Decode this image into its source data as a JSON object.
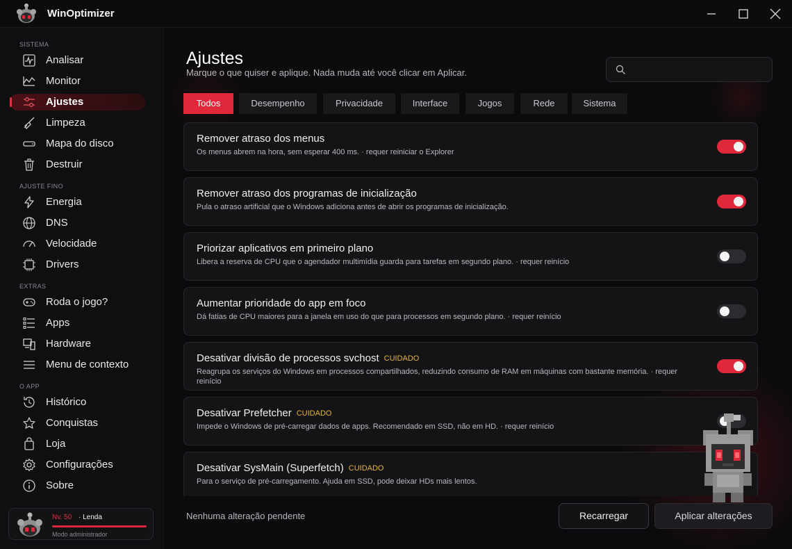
{
  "app": {
    "title": "WinOptimizer"
  },
  "sidebar": {
    "sections": [
      {
        "label": "SISTEMA",
        "items": [
          {
            "label": "Analisar",
            "icon": "pulse-icon"
          },
          {
            "label": "Monitor",
            "icon": "chart-area-icon"
          },
          {
            "label": "Ajustes",
            "icon": "sliders-icon",
            "active": true
          },
          {
            "label": "Limpeza",
            "icon": "broom-icon"
          },
          {
            "label": "Mapa do disco",
            "icon": "disk-icon"
          },
          {
            "label": "Destruir",
            "icon": "trash-icon"
          }
        ]
      },
      {
        "label": "AJUSTE FINO",
        "items": [
          {
            "label": "Energia",
            "icon": "bolt-icon"
          },
          {
            "label": "DNS",
            "icon": "globe-icon"
          },
          {
            "label": "Velocidade",
            "icon": "speed-icon"
          },
          {
            "label": "Drivers",
            "icon": "chip-icon"
          }
        ]
      },
      {
        "label": "EXTRAS",
        "items": [
          {
            "label": "Roda o jogo?",
            "icon": "gamepad-icon"
          },
          {
            "label": "Apps",
            "icon": "list-icon"
          },
          {
            "label": "Hardware",
            "icon": "hardware-icon"
          },
          {
            "label": "Menu de contexto",
            "icon": "menu-icon"
          }
        ]
      },
      {
        "label": "O APP",
        "items": [
          {
            "label": "Histórico",
            "icon": "history-icon"
          },
          {
            "label": "Conquistas",
            "icon": "star-icon"
          },
          {
            "label": "Loja",
            "icon": "bag-icon"
          },
          {
            "label": "Configurações",
            "icon": "gear-icon"
          },
          {
            "label": "Sobre",
            "icon": "info-icon"
          }
        ]
      }
    ],
    "user": {
      "level": "Nv. 50",
      "rank": "· Lenda",
      "mode": "Modo administrador",
      "progress": 1.0
    }
  },
  "main": {
    "title": "Ajustes",
    "subtitle": "Marque o que quiser e aplique. Nada muda até você clicar em Aplicar.",
    "search": {
      "placeholder": "",
      "value": ""
    },
    "tabs": [
      {
        "label": "Todos",
        "active": true
      },
      {
        "label": "Desempenho"
      },
      {
        "label": "Privacidade"
      },
      {
        "label": "Interface"
      },
      {
        "label": "Jogos"
      },
      {
        "label": "Rede"
      },
      {
        "label": "Sistema"
      }
    ],
    "tweaks": [
      {
        "title": "Remover atraso dos menus",
        "caution": "",
        "description": "Os menus abrem na hora, sem esperar 400 ms.  ·  requer reiniciar o Explorer",
        "enabled": true
      },
      {
        "title": "Remover atraso dos programas de inicialização",
        "caution": "",
        "description": "Pula o atraso artificial que o Windows adiciona antes de abrir os programas de inicialização.",
        "enabled": true
      },
      {
        "title": "Priorizar aplicativos em primeiro plano",
        "caution": "",
        "description": "Libera a reserva de CPU que o agendador multimídia guarda para tarefas em segundo plano.  ·  requer reinício",
        "enabled": false
      },
      {
        "title": "Aumentar prioridade do app em foco",
        "caution": "",
        "description": "Dá fatias de CPU maiores para a janela em uso do que para processos em segundo plano.  ·  requer reinício",
        "enabled": false
      },
      {
        "title": "Desativar divisão de processos svchost",
        "caution": "CUIDADO",
        "description": "Reagrupa os serviços do Windows em processos compartilhados, reduzindo consumo de RAM em máquinas com bastante memória.  ·  requer reinício",
        "enabled": true
      },
      {
        "title": "Desativar Prefetcher",
        "caution": "CUIDADO",
        "description": "Impede o Windows de pré-carregar dados de apps. Recomendado em SSD, não em HD.  ·  requer reinício",
        "enabled": false
      },
      {
        "title": "Desativar SysMain (Superfetch)",
        "caution": "CUIDADO",
        "description": "Para o serviço de pré-carregamento. Ajuda em SSD, pode deixar HDs mais lentos.",
        "enabled": false
      }
    ],
    "status": "Nenhuma alteração pendente",
    "buttons": {
      "reload": "Recarregar",
      "apply": "Aplicar alterações"
    }
  },
  "colors": {
    "accent": "#e0283a",
    "caution": "#e8b33a",
    "background": "#0b0b0d"
  }
}
